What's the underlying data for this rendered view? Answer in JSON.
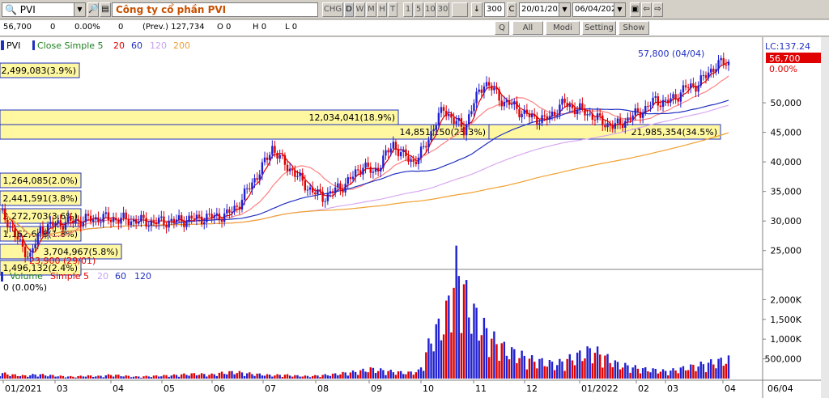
{
  "toolbar": {
    "symbol": "PVI",
    "company": "Công ty cổ phần PVI",
    "chart_button": "CHG",
    "period_buttons": [
      "D",
      "W",
      "M",
      "H",
      "T"
    ],
    "minute_buttons": [
      "1",
      "5",
      "10",
      "30"
    ],
    "bars": "300",
    "c_button": "C",
    "date_from": "20/01/202",
    "date_to": "06/04/202"
  },
  "quote_bar": {
    "price": "56,700",
    "change": "0",
    "percent": "0.00%",
    "volume": "0",
    "prev": "(Prev.) 127,734",
    "open": "O 0",
    "high": "H 0",
    "low": "L 0",
    "buttons": [
      "Q",
      "All",
      "Modi",
      "Setting",
      "Show"
    ]
  },
  "price_panel": {
    "symbol_tag": "PVI",
    "legend_label": "Close Simple 5",
    "legend_periods": [
      "20",
      "60",
      "120",
      "200"
    ],
    "lc_label": "LC:137.24",
    "last_price": "56,700",
    "last_pct": "0.00%",
    "high_annotation": "57,800 (04/04)",
    "low_annotation": "23,900 (29/01)",
    "volume_profile_labels": [
      "2,499,083(3.9%)",
      "12,034,041(18.9%)",
      "21,985,354(34.5%)",
      "14,851,150(23.3%)",
      "1,264,085(2.0%)",
      "2,441,591(3.8%)",
      "2,272,703(3.6%)",
      "1,162,646(1.8%)",
      "3,704,967(5.8%)",
      "1,496,132(2.4%)"
    ],
    "y_ticks": [
      "50,000",
      "45,000",
      "40,000",
      "35,000",
      "30,000",
      "25,000"
    ]
  },
  "volume_panel": {
    "legend_label": "Volume",
    "legend_ma": "Simple 5",
    "legend_periods": [
      "20",
      "60",
      "120"
    ],
    "value": "0 (0.00%)",
    "y_ticks": [
      "2,000K",
      "1,500K",
      "1,000K",
      "500,000"
    ]
  },
  "x_axis": [
    "01/2021",
    "03",
    "04",
    "05",
    "06",
    "07",
    "08",
    "09",
    "10",
    "11",
    "12",
    "01/2022",
    "02",
    "03",
    "04"
  ],
  "x_axis_right": "06/04",
  "colors": {
    "up": "#2020d0",
    "down": "#e00000",
    "ma5": "#e00000",
    "ma20": "#ff8080",
    "ma60": "#2030c0",
    "ma120": "#d8a8f0",
    "ma200": "#f0a030",
    "profile": "#fff8a0"
  },
  "chart_data": {
    "type": "candlestick",
    "ylim": [
      22500,
      60000
    ],
    "x_months": [
      "01/2021",
      "03",
      "04",
      "05",
      "06",
      "07",
      "08",
      "09",
      "10",
      "11",
      "12",
      "01/2022",
      "02",
      "03",
      "04"
    ],
    "close_path": [
      [
        0,
        31500
      ],
      [
        3,
        30000
      ],
      [
        8,
        26000
      ],
      [
        12,
        24000
      ],
      [
        16,
        28500
      ],
      [
        22,
        29500
      ],
      [
        30,
        30000
      ],
      [
        40,
        30500
      ],
      [
        50,
        30200
      ],
      [
        60,
        29800
      ],
      [
        70,
        30000
      ],
      [
        80,
        30500
      ],
      [
        90,
        31000
      ],
      [
        95,
        33000
      ],
      [
        100,
        36500
      ],
      [
        104,
        39000
      ],
      [
        108,
        42500
      ],
      [
        112,
        40000
      ],
      [
        116,
        38500
      ],
      [
        120,
        36500
      ],
      [
        124,
        35000
      ],
      [
        128,
        34000
      ],
      [
        132,
        35000
      ],
      [
        136,
        36000
      ],
      [
        140,
        37500
      ],
      [
        144,
        39500
      ],
      [
        148,
        38000
      ],
      [
        152,
        40500
      ],
      [
        156,
        43000
      ],
      [
        160,
        41000
      ],
      [
        164,
        40000
      ],
      [
        168,
        42000
      ],
      [
        172,
        46000
      ],
      [
        176,
        49000
      ],
      [
        180,
        47000
      ],
      [
        184,
        45500
      ],
      [
        188,
        50000
      ],
      [
        192,
        53500
      ],
      [
        196,
        52000
      ],
      [
        200,
        50000
      ],
      [
        204,
        49500
      ],
      [
        208,
        48000
      ],
      [
        212,
        47500
      ],
      [
        216,
        47000
      ],
      [
        220,
        48500
      ],
      [
        224,
        50000
      ],
      [
        228,
        49000
      ],
      [
        232,
        48500
      ],
      [
        236,
        47500
      ],
      [
        240,
        46500
      ],
      [
        244,
        46000
      ],
      [
        248,
        47000
      ],
      [
        252,
        48000
      ],
      [
        256,
        49000
      ],
      [
        260,
        50500
      ],
      [
        264,
        50000
      ],
      [
        268,
        51000
      ],
      [
        272,
        52500
      ],
      [
        276,
        53000
      ],
      [
        280,
        54500
      ],
      [
        284,
        56500
      ],
      [
        288,
        56700
      ]
    ],
    "volume_k": [
      120,
      80,
      60,
      90,
      70,
      50,
      40,
      60,
      50,
      80,
      60,
      40,
      50,
      60,
      70,
      90,
      100,
      80,
      120,
      140,
      110,
      90,
      70,
      80,
      60,
      50,
      70,
      90,
      120,
      150,
      200,
      170,
      140,
      120,
      160,
      900,
      1200,
      2300,
      1500,
      1100,
      800,
      600,
      500,
      400,
      350,
      300,
      400,
      500,
      600,
      450,
      300,
      250,
      200,
      180,
      150,
      200,
      250,
      300,
      350,
      400
    ]
  }
}
